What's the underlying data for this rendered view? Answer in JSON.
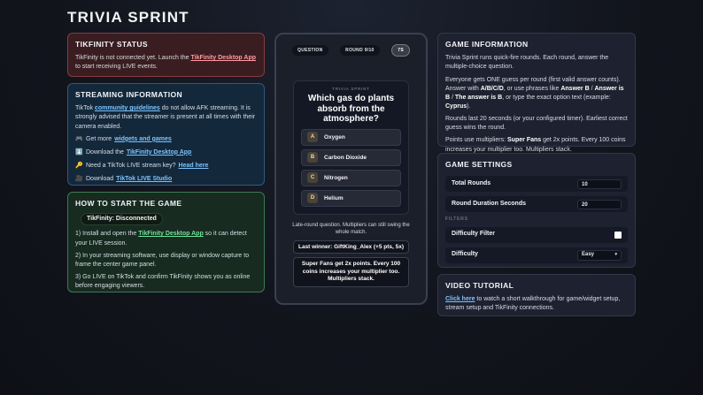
{
  "page": {
    "title": "TRIVIA SPRINT"
  },
  "tikfinity_status": {
    "heading": "TIKFINITY STATUS",
    "text_before": "TikFinity is not connected yet. Launch the ",
    "link": "TikFinity Desktop App",
    "text_after": " to start receiving LIVE events."
  },
  "streaming": {
    "heading": "STREAMING INFORMATION",
    "p1_before": "TikTok ",
    "p1_link": "community guidelines",
    "p1_after": " do not allow AFK streaming. It is strongly advised that the streamer is present at all times with their camera enabled.",
    "l1_icon": "🎮",
    "l1_text": "Get more ",
    "l1_link": "widgets and games",
    "l2_icon": "⬇️",
    "l2_text": "Download the ",
    "l2_link": "TikFinity Desktop App",
    "l3_icon": "🔑",
    "l3_text": "Need a TikTok LIVE stream key? ",
    "l3_link": "Head here",
    "l4_icon": "🎥",
    "l4_text": "Download ",
    "l4_link": "TikTok LIVE Studio"
  },
  "howto": {
    "heading": "HOW TO START THE GAME",
    "status_pill": "TikFinity: Disconnected",
    "s1_before": "1) Install and open the ",
    "s1_link": "TikFinity Desktop App",
    "s1_after": " so it can detect your LIVE session.",
    "s2": "2) In your streaming software, use display or window capture to frame the center game panel.",
    "s3": "3) Go LIVE on TikTok and confirm TikFinity shows you as online before engaging viewers."
  },
  "game": {
    "phase_label": "QUESTION",
    "round_label": "ROUND 9/10",
    "timer": "7S",
    "header": "TRIVIA SPRINT",
    "question": "Which gas do plants absorb from the atmosphere?",
    "answers": [
      {
        "letter": "A",
        "text": "Oxygen"
      },
      {
        "letter": "B",
        "text": "Carbon Dioxide"
      },
      {
        "letter": "C",
        "text": "Nitrogen"
      },
      {
        "letter": "D",
        "text": "Helium"
      }
    ],
    "late_note": "Late-round question. Multipliers can still swing the whole match.",
    "last_winner": "Last winner: GiftKing_Alex (+5 pts, 5x)",
    "superfans_note": "Super Fans get 2x points. Every 100 coins increases your multiplier too. Multipliers stack."
  },
  "game_info": {
    "heading": "GAME INFORMATION",
    "p1": "Trivia Sprint runs quick-fire rounds. Each round, answer the multiple-choice question.",
    "p2_a": "Everyone gets ONE guess per round (first valid answer counts). Answer with ",
    "p2_b": "A/B/C/D",
    "p2_c": ", or use phrases like ",
    "p2_d": "Answer B",
    "p2_e": " / ",
    "p2_f": "Answer is B",
    "p2_g": " / ",
    "p2_h": "The answer is B",
    "p2_i": ", or type the exact option text (example: ",
    "p2_j": "Cyprus",
    "p2_k": ").",
    "p3": "Rounds last 20 seconds (or your configured timer). Earliest correct guess wins the round.",
    "p4_a": "Points use multipliers: ",
    "p4_b": "Super Fans",
    "p4_c": " get 2x points. Every 100 coins increases your multiplier too. Multipliers stack."
  },
  "settings": {
    "heading": "GAME SETTINGS",
    "total_rounds_label": "Total Rounds",
    "total_rounds_value": "10",
    "round_duration_label": "Round Duration Seconds",
    "round_duration_value": "20",
    "filters_label": "FILTERS",
    "difficulty_filter_label": "Difficulty Filter",
    "difficulty_label": "Difficulty",
    "difficulty_value": "Easy"
  },
  "video": {
    "heading": "VIDEO TUTORIAL",
    "link": "Click here",
    "text": " to watch a short walkthrough for game/widget setup, stream setup and TikFinity connections."
  }
}
